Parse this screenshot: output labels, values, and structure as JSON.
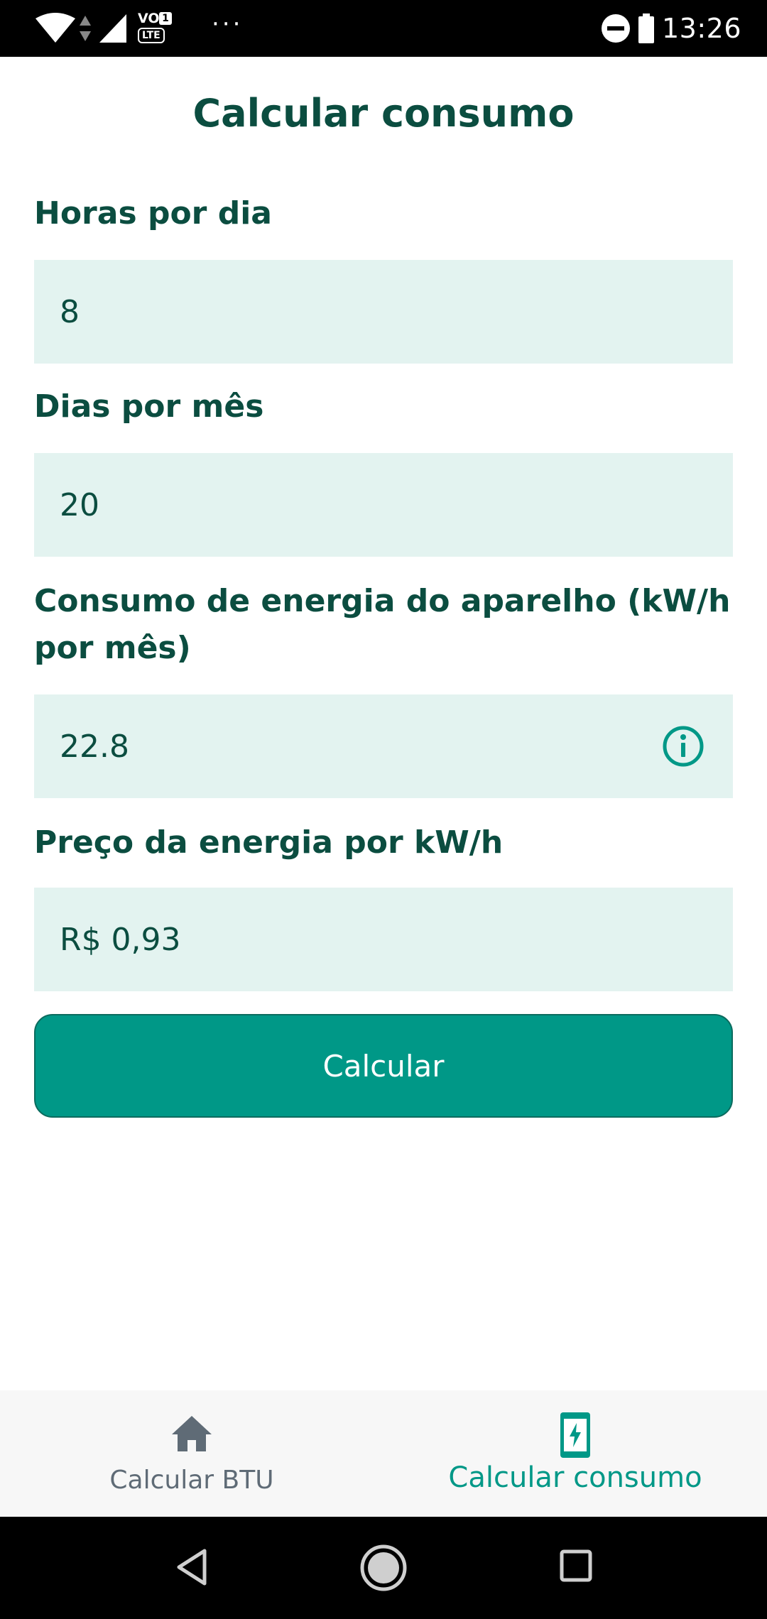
{
  "status_bar": {
    "time": "13:26",
    "volte_label": "VO",
    "lte_label": "LTE",
    "sim_number": "1",
    "overflow": "···",
    "icons": [
      "wifi-icon",
      "signal-icon",
      "volte-icon",
      "dnd-icon",
      "battery-icon"
    ]
  },
  "page": {
    "title": "Calcular consumo"
  },
  "form": {
    "hours": {
      "label": "Horas por dia",
      "value": "8"
    },
    "days": {
      "label": "Dias por mês",
      "value": "20"
    },
    "consumption": {
      "label": "Consumo de energia do aparelho (kW/h por mês)",
      "value": "22.8",
      "info_icon": "info-circle-icon"
    },
    "price": {
      "label": "Preço da energia por kW/h",
      "value": "R$ 0,93"
    },
    "submit_label": "Calcular"
  },
  "bottom_nav": {
    "items": [
      {
        "label": "Calcular BTU",
        "icon": "home-icon",
        "active": false
      },
      {
        "label": "Calcular consumo",
        "icon": "phone-charging-icon",
        "active": true
      }
    ]
  },
  "system_nav": {
    "icons": [
      "back-icon",
      "home-circle-icon",
      "recents-icon"
    ]
  },
  "colors": {
    "primary": "#009887",
    "title_text": "#0b4d40",
    "field_background": "#e3f3f0",
    "nav_inactive": "#5f6b76"
  }
}
